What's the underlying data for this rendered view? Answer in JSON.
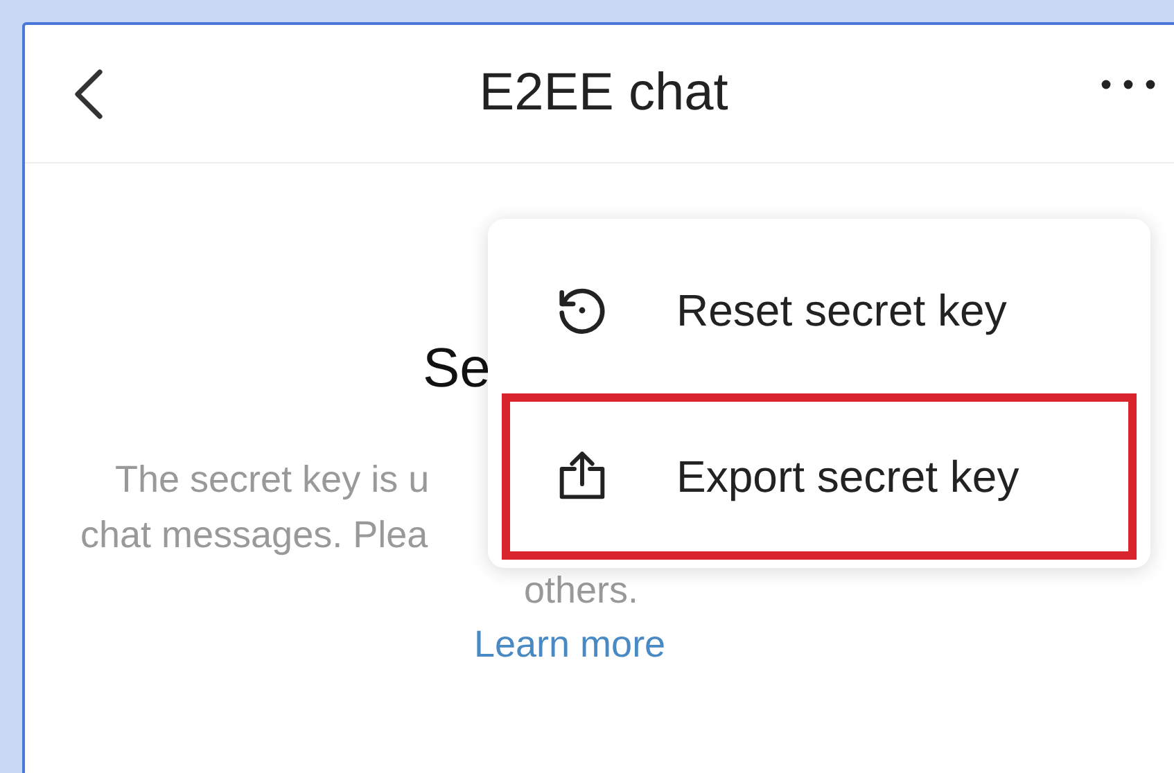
{
  "header": {
    "title": "E2EE chat"
  },
  "body": {
    "heading": "Se",
    "description_lines": [
      "The secret key is u",
      "chat messages. Plea",
      "others."
    ],
    "link": "Learn more"
  },
  "menu": {
    "items": [
      {
        "kind": "reset",
        "label": "Reset secret key",
        "highlighted": false
      },
      {
        "kind": "export",
        "label": "Export secret key",
        "highlighted": true
      }
    ]
  }
}
